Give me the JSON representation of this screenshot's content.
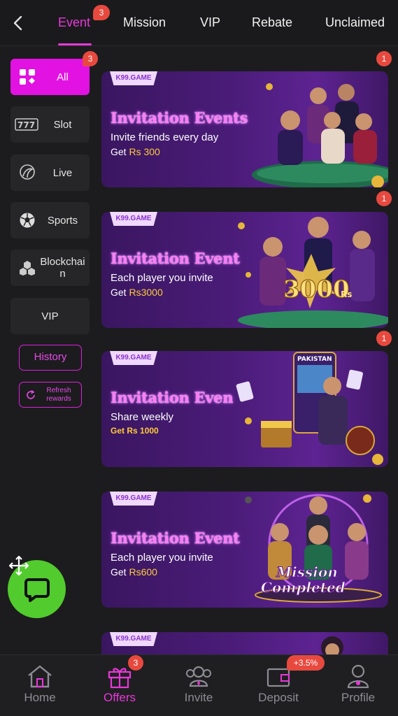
{
  "tabs": [
    {
      "label": "Event",
      "active": true,
      "badge": "3"
    },
    {
      "label": "Mission",
      "active": false
    },
    {
      "label": "VIP",
      "active": false
    },
    {
      "label": "Rebate",
      "active": false
    },
    {
      "label": "Unclaimed",
      "active": false
    }
  ],
  "sidebar": {
    "items": [
      {
        "label": "All",
        "icon": "grid-icon",
        "active": true,
        "badge": "3"
      },
      {
        "label": "Slot",
        "icon": "slot-777-icon"
      },
      {
        "label": "Live",
        "icon": "live-dealer-icon"
      },
      {
        "label": "Sports",
        "icon": "soccer-ball-icon"
      },
      {
        "label": "Blockchain",
        "icon": "blockchain-icon"
      },
      {
        "label": "VIP",
        "icon": ""
      }
    ],
    "history_label": "History",
    "refresh_label": "Refresh rewards"
  },
  "cards": [
    {
      "tag": "K99.GAME",
      "title": "Invitation Events",
      "line1": "Invite friends every day",
      "line2_prefix": "Get ",
      "amount": "Rs 300",
      "badge": "1"
    },
    {
      "tag": "K99.GAME",
      "title": "Invitation Event",
      "line1": "Each player you invite",
      "line2_prefix": "Get ",
      "amount": "Rs3000",
      "badge": "1",
      "art_text": "3000",
      "art_sub": "Rs"
    },
    {
      "tag": "K99.GAME",
      "title": "Invitation Even",
      "line1": "Share weekly",
      "line2_prefix": "Get ",
      "amount": "Rs 1000",
      "badge": "1",
      "art_text": "PAKISTAN"
    },
    {
      "tag": "K99.GAME",
      "title": "Invitation Event",
      "line1": "Each player you invite",
      "line2_prefix": "Get ",
      "amount": "Rs600",
      "art_text": "Mission",
      "art_sub": "Completed"
    },
    {
      "tag": "K99.GAME"
    }
  ],
  "bottom_nav": [
    {
      "label": "Home",
      "icon": "home-icon"
    },
    {
      "label": "Offers",
      "icon": "gift-icon",
      "active": true,
      "badge": "3"
    },
    {
      "label": "Invite",
      "icon": "invite-users-icon"
    },
    {
      "label": "Deposit",
      "icon": "wallet-icon",
      "badge": "+3.5%"
    },
    {
      "label": "Profile",
      "icon": "profile-icon"
    }
  ],
  "colors": {
    "accent": "#e838d9",
    "badge": "#e8493f",
    "amount": "#ffcb3a",
    "chat": "#52cb2e",
    "sidebar_active": "#e212e2"
  }
}
